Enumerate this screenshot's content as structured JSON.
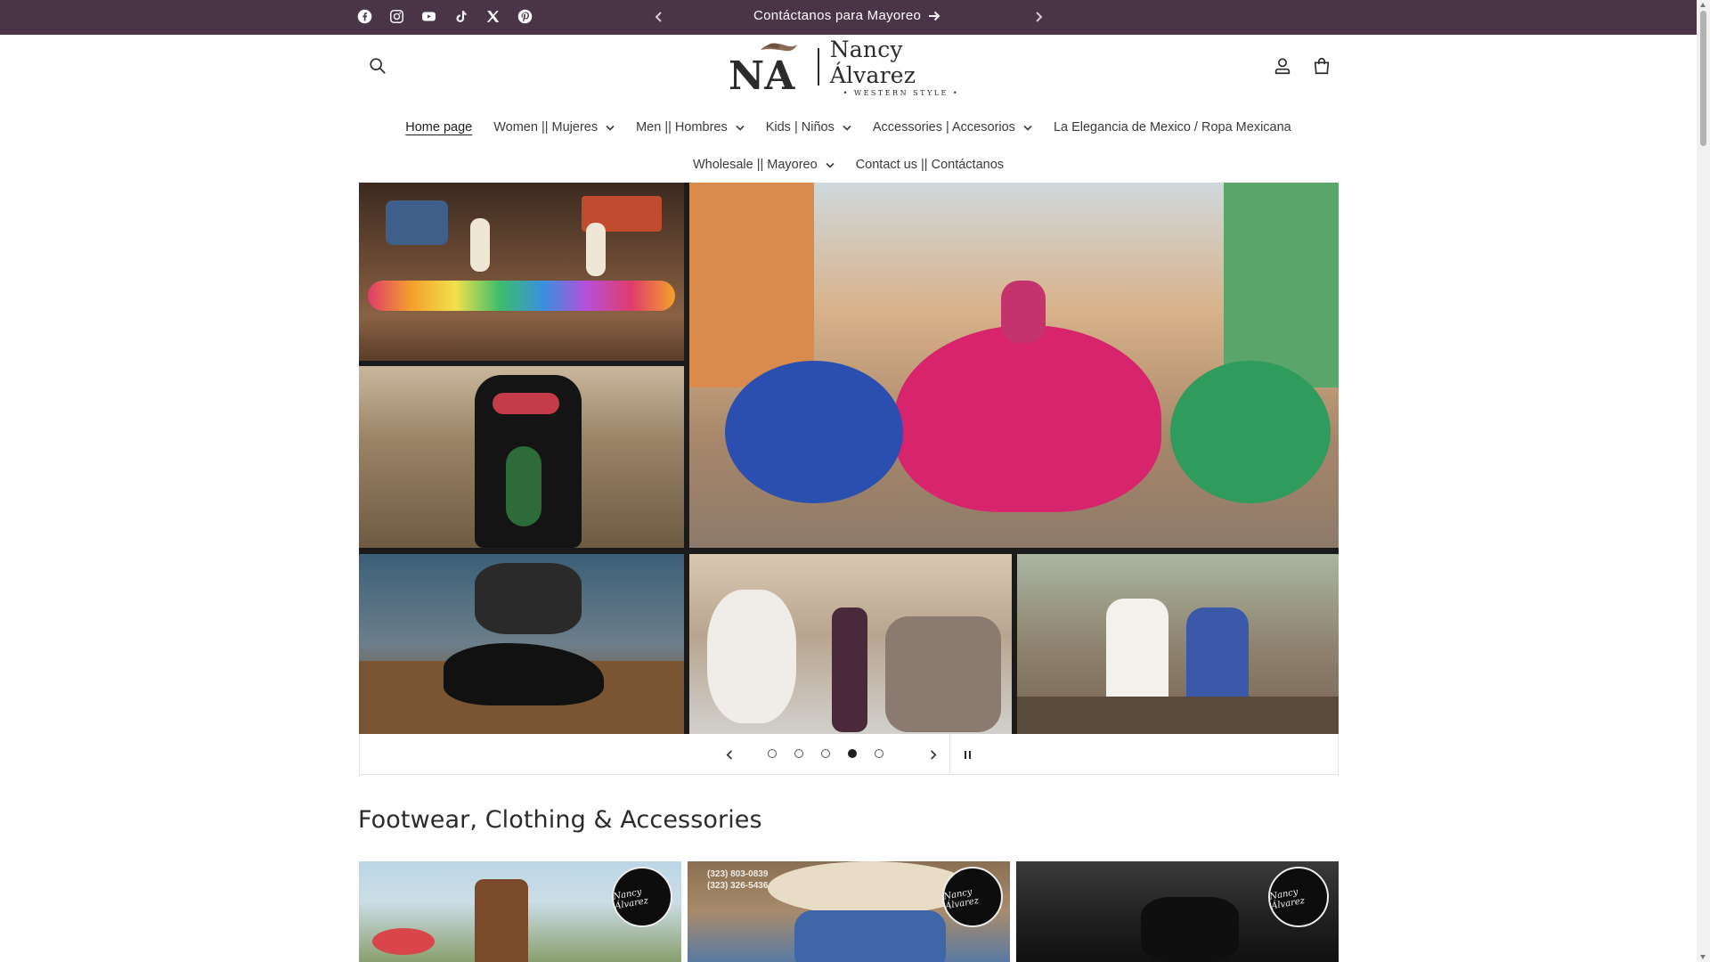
{
  "announcement": {
    "social": [
      "facebook-icon",
      "instagram-icon",
      "youtube-icon",
      "tiktok-icon",
      "x-icon",
      "pinterest-icon"
    ],
    "message": "Contáctanos para Mayoreo",
    "background": "#4a3448"
  },
  "header": {
    "logo_monogram": "NA",
    "logo_name": "Nancy Álvarez",
    "logo_tagline": "• WESTERN STYLE •"
  },
  "nav": {
    "row1": [
      {
        "label": "Home page",
        "dropdown": false,
        "active": true
      },
      {
        "label": "Women || Mujeres",
        "dropdown": true
      },
      {
        "label": "Men || Hombres",
        "dropdown": true
      },
      {
        "label": "Kids | Niños",
        "dropdown": true
      },
      {
        "label": "Accessories | Accesorios",
        "dropdown": true
      },
      {
        "label": "La Elegancia de Mexico / Ropa Mexicana",
        "dropdown": false
      }
    ],
    "row2": [
      {
        "label": "Wholesale || Mayoreo",
        "dropdown": true
      },
      {
        "label": "Contact us || Contáctanos",
        "dropdown": false
      }
    ]
  },
  "slideshow": {
    "slide_count": 5,
    "active_slide": 4
  },
  "section": {
    "title": "Footwear, Clothing & Accessories",
    "cards": [
      {
        "badge": "Nancy Álvarez",
        "phone": ""
      },
      {
        "badge": "Nancy Álvarez",
        "phone": "(323) 803-0839\n(323) 326-5436"
      },
      {
        "badge": "Nancy Álvarez",
        "phone": ""
      }
    ]
  }
}
